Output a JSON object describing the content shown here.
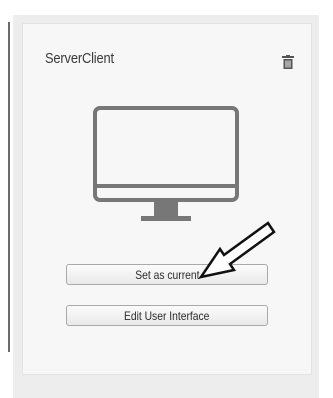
{
  "card": {
    "title": "ServerClient"
  },
  "buttons": {
    "set_current": "Set as current",
    "edit_ui": "Edit User Interface"
  },
  "icons": {
    "delete": "trash-icon",
    "device": "monitor-icon",
    "pointer": "arrow-annotation"
  },
  "colors": {
    "icon_gray": "#777777",
    "panel_bg": "#ededed",
    "card_bg": "#f7f7f7"
  }
}
